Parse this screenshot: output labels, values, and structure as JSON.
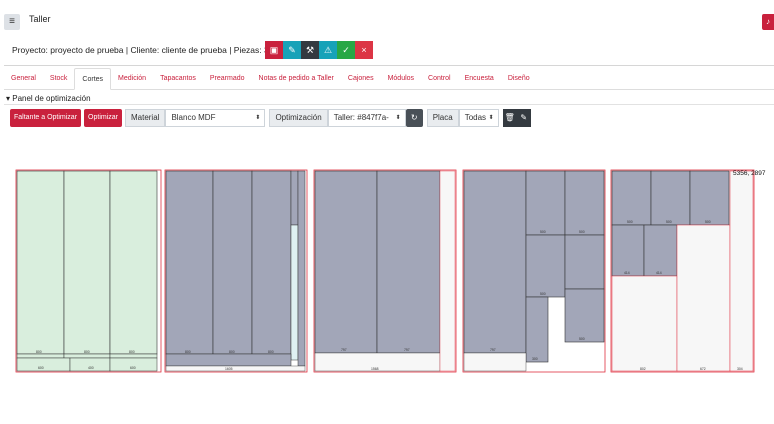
{
  "header": {
    "title": "Taller",
    "menu_icon": "hamburger-icon",
    "bell_icon": "bell-icon"
  },
  "project": {
    "line": "Proyecto: proyecto de prueba | Cliente: cliente de prueba | Piezas: 36"
  },
  "actions": [
    {
      "icon": "image-icon",
      "color": "#c9213d"
    },
    {
      "icon": "pencil-icon",
      "color": "#17a2b8"
    },
    {
      "icon": "hammer-icon",
      "color": "#343a40"
    },
    {
      "icon": "warning-icon",
      "color": "#17a2b8"
    },
    {
      "icon": "check-icon",
      "color": "#28a745"
    },
    {
      "icon": "close-icon",
      "color": "#dc3545"
    }
  ],
  "tabs": [
    "General",
    "Stock",
    "Cortes",
    "Medición",
    "Tapacantos",
    "Prearmado",
    "Notas de pedido a Taller",
    "Cajones",
    "Módulos",
    "Control",
    "Encuesta",
    "Diseño"
  ],
  "active_tab": "Cortes",
  "panel": {
    "title": "Panel de optimización"
  },
  "toolbar": {
    "faltante_label": "Faltante a Optimizar",
    "optimizar_label": "Optimizar",
    "material_label": "Material",
    "material_value": "Blanco MDF",
    "optimizacion_label": "Optimización",
    "optimizacion_value": "Taller: #847f7a-",
    "placa_label": "Placa",
    "placa_value": "Todas"
  },
  "sheets_info": {
    "corner_label": "5356, 2897"
  },
  "sheet_colors": {
    "piece_green": "#d9eedd",
    "piece_gray": "#a2a6b8",
    "border_red": "#e03040",
    "waste": "#f7f7f7"
  }
}
